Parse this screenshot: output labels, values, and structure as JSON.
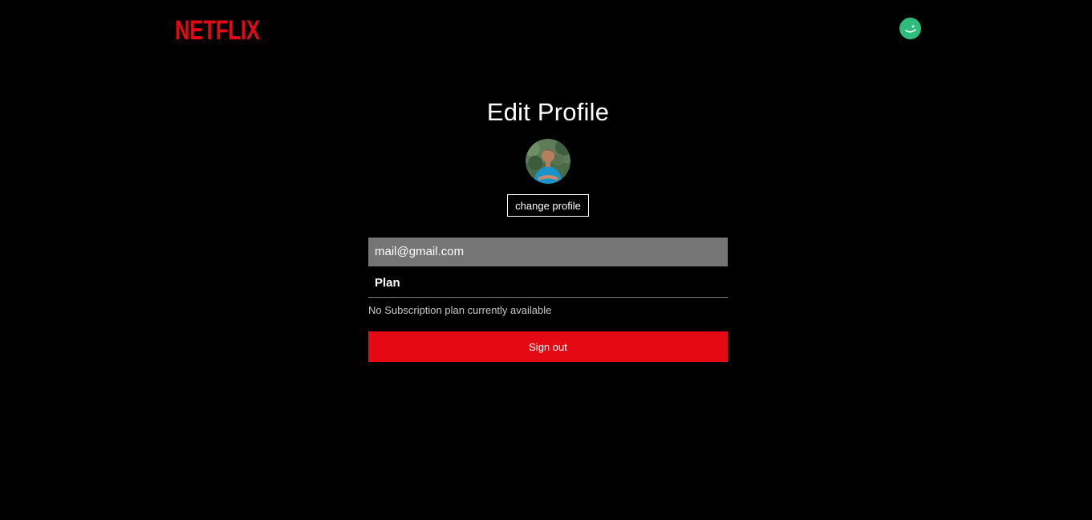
{
  "nav": {
    "logo_text": "NETFLIX",
    "logo_color": "#e50914",
    "avatar_icon": "smiley-avatar-icon",
    "avatar_color": "#2dbc79"
  },
  "main": {
    "title": "Edit Profile",
    "profile_image": "user-photo",
    "change_profile_label": "change profile",
    "email": "mail@gmail.com",
    "plan_heading": "Plan",
    "plan_note": "No Subscription plan currently available",
    "signout_label": "Sign out",
    "accent_color": "#e50914"
  }
}
